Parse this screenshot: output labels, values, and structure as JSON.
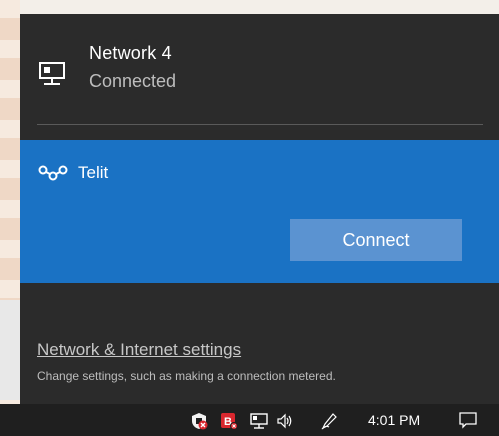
{
  "networks": [
    {
      "name": "Network  4",
      "status": "Connected",
      "icon": "wired-network-icon"
    },
    {
      "name": "Telit",
      "icon": "cellular-network-icon",
      "action_label": "Connect"
    }
  ],
  "settings": {
    "link_label": "Network & Internet settings",
    "description": "Change settings, such as making a connection metered."
  },
  "taskbar": {
    "time": "4:01 PM",
    "icons": [
      "security-shield-icon",
      "b-app-icon",
      "network-icon",
      "volume-icon",
      "pen-icon",
      "action-center-icon"
    ]
  },
  "colors": {
    "flyout_bg": "#2b2b2b",
    "selected_bg": "#1a72c4",
    "button_bg": "#5b93d1",
    "taskbar_bg": "#1f1f1f"
  }
}
